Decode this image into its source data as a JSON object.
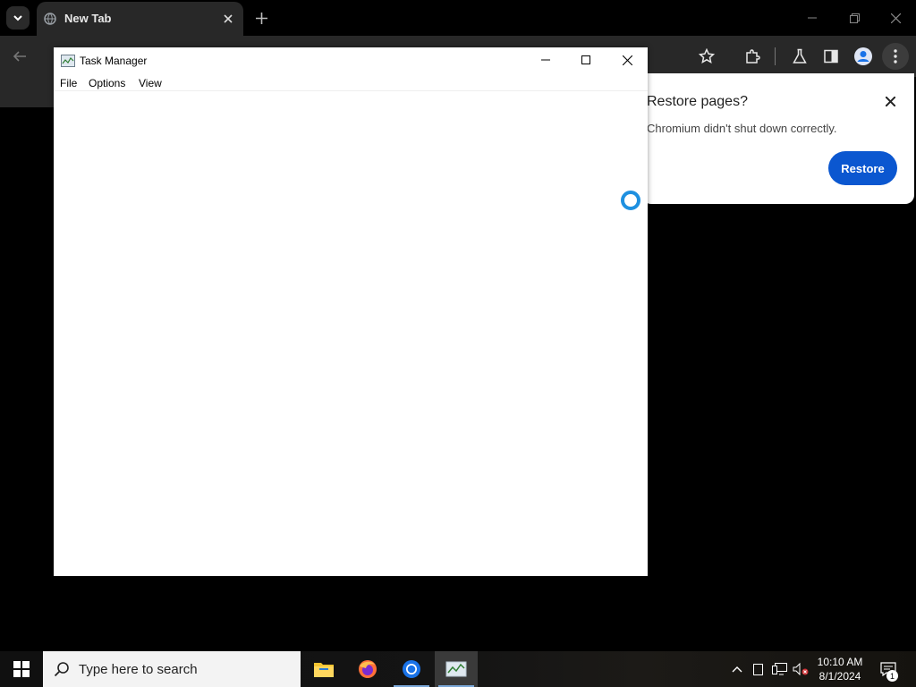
{
  "browser": {
    "tab": {
      "title": "New Tab",
      "icon": "globe-icon"
    },
    "icons": {
      "tab_search": "chevron-down-icon",
      "new_tab": "plus-icon",
      "back": "arrow-left-icon",
      "bookmark": "star-icon",
      "extensions": "puzzle-icon",
      "labs": "flask-icon",
      "side_panel": "side-panel-icon",
      "profile": "avatar-icon",
      "menu": "kebab-menu-icon"
    }
  },
  "restore_bubble": {
    "title": "Restore pages?",
    "message": "Chromium didn't shut down correctly.",
    "button_label": "Restore",
    "accent_color": "#0b57d0"
  },
  "task_manager": {
    "title": "Task Manager",
    "menu": [
      "File",
      "Options",
      "View"
    ]
  },
  "taskbar": {
    "search_placeholder": "Type here to search",
    "pinned_apps": [
      "File Explorer",
      "Firefox",
      "Chromium",
      "Task Manager"
    ],
    "clock_time": "10:10 AM",
    "clock_date": "8/1/2024",
    "notification_count": "1"
  }
}
